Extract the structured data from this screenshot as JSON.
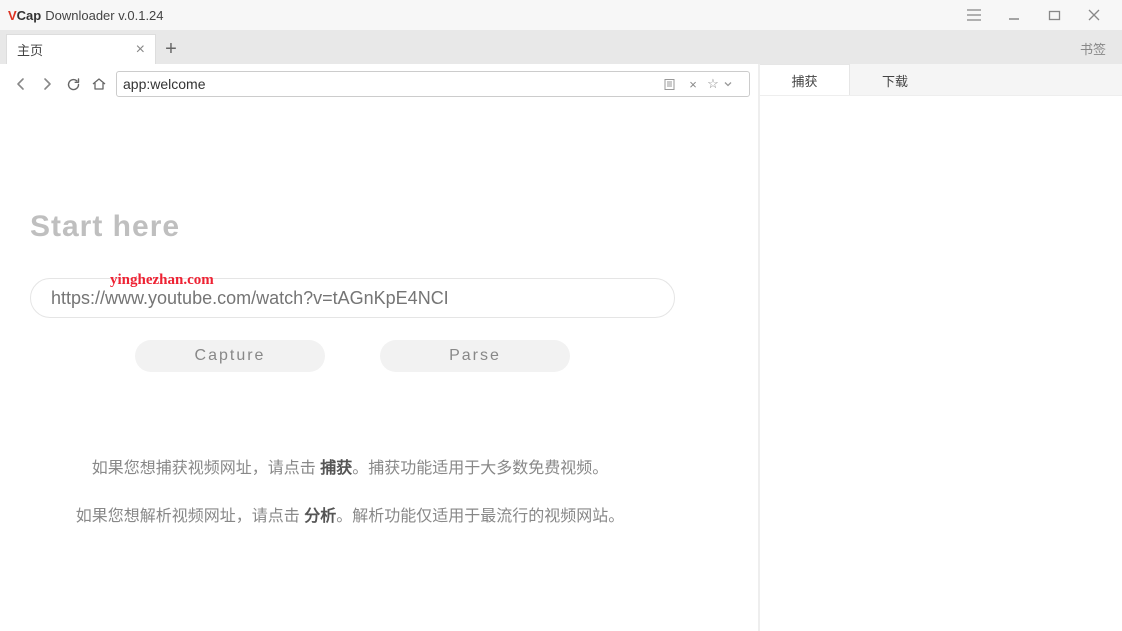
{
  "titlebar": {
    "logo_prefix": "V",
    "logo_suffix": "Cap",
    "title": "Downloader  v.0.1.24"
  },
  "tabs": {
    "home_label": "主页",
    "bookmark": "书签"
  },
  "nav": {
    "url": "app:welcome"
  },
  "welcome": {
    "heading": "Start here",
    "url_placeholder": "https://www.youtube.com/watch?v=tAGnKpE4NCI",
    "watermark": "yinghezhan.com",
    "capture_btn": "Capture",
    "parse_btn": "Parse",
    "help1_a": "如果您想捕获视频网址，请点击 ",
    "help1_bold": "捕获",
    "help1_b": "。捕获功能适用于大多数免费视频。",
    "help2_a": "如果您想解析视频网址，请点击 ",
    "help2_bold": "分析",
    "help2_b": "。解析功能仅适用于最流行的视频网站。"
  },
  "sidepanel": {
    "capture_tab": "捕获",
    "download_tab": "下载"
  }
}
